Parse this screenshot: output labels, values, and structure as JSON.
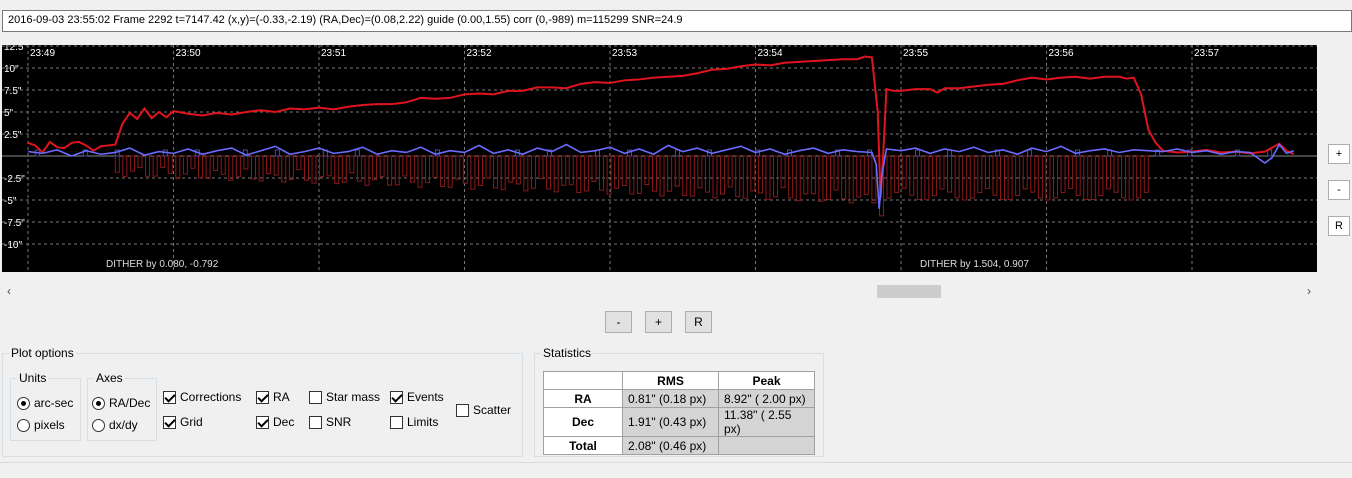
{
  "info_text": "2016-09-03 23:55:02 Frame 2292 t=7147.42 (x,y)=(-0.33,-2.19) (RA,Dec)=(0.08,2.22) guide (0.00,1.55) corr (0,-989) m=115299 SNR=24.9",
  "chart_data": {
    "type": "line",
    "x_ticks": [
      "23:49",
      "23:50",
      "23:51",
      "23:52",
      "23:53",
      "23:54",
      "23:55",
      "23:56",
      "23:57"
    ],
    "y_ticks": [
      "12.5\"",
      "10\"",
      "7.5\"",
      "5\"",
      "2.5\"",
      "-2.5\"",
      "-5\"",
      "-7.5\"",
      "-10\""
    ],
    "ylim": [
      -11,
      13.5
    ],
    "grid": true,
    "annotations": [
      {
        "label": "DITHER by 0.080, -0.792",
        "x": "23:49:35"
      },
      {
        "label": "DITHER by 1.504, 0.907",
        "x": "23:55:00"
      }
    ],
    "series": [
      {
        "name": "RA",
        "color": "#e0141e",
        "points": [
          [
            0,
            1.5
          ],
          [
            0.05,
            1.2
          ],
          [
            0.1,
            0.4
          ],
          [
            0.15,
            1.6
          ],
          [
            0.2,
            1.0
          ],
          [
            0.25,
            0.9
          ],
          [
            0.3,
            1.5
          ],
          [
            0.35,
            1.6
          ],
          [
            0.4,
            1.2
          ],
          [
            0.45,
            0.6
          ],
          [
            0.5,
            1.1
          ],
          [
            0.55,
            1.2
          ],
          [
            0.6,
            1.3
          ],
          [
            0.65,
            3.7
          ],
          [
            0.7,
            4.9
          ],
          [
            0.75,
            4.2
          ],
          [
            0.8,
            5.4
          ],
          [
            0.85,
            4.3
          ],
          [
            0.9,
            5.0
          ],
          [
            0.95,
            4.4
          ],
          [
            1.0,
            5.1
          ],
          [
            1.1,
            4.8
          ],
          [
            1.2,
            4.6
          ],
          [
            1.3,
            4.9
          ],
          [
            1.4,
            4.7
          ],
          [
            1.5,
            5.0
          ],
          [
            1.6,
            5.2
          ],
          [
            1.7,
            5.0
          ],
          [
            1.8,
            5.4
          ],
          [
            1.9,
            5.3
          ],
          [
            2.0,
            5.5
          ],
          [
            2.1,
            5.3
          ],
          [
            2.2,
            5.6
          ],
          [
            2.3,
            5.8
          ],
          [
            2.4,
            5.9
          ],
          [
            2.5,
            5.9
          ],
          [
            2.6,
            6.1
          ],
          [
            2.7,
            6.6
          ],
          [
            2.8,
            6.5
          ],
          [
            2.9,
            6.6
          ],
          [
            3.0,
            7.0
          ],
          [
            3.1,
            7.1
          ],
          [
            3.2,
            7.0
          ],
          [
            3.3,
            7.4
          ],
          [
            3.4,
            7.4
          ],
          [
            3.5,
            7.8
          ],
          [
            3.6,
            7.8
          ],
          [
            3.7,
            7.7
          ],
          [
            3.8,
            8.2
          ],
          [
            3.9,
            8.4
          ],
          [
            4.0,
            8.3
          ],
          [
            4.1,
            8.6
          ],
          [
            4.2,
            8.7
          ],
          [
            4.3,
            8.9
          ],
          [
            4.4,
            9.0
          ],
          [
            4.5,
            9.1
          ],
          [
            4.6,
            9.4
          ],
          [
            4.7,
            9.8
          ],
          [
            4.8,
            9.9
          ],
          [
            4.9,
            10.2
          ],
          [
            5.0,
            10.4
          ],
          [
            5.1,
            10.3
          ],
          [
            5.2,
            10.6
          ],
          [
            5.3,
            10.7
          ],
          [
            5.4,
            10.8
          ],
          [
            5.5,
            10.9
          ],
          [
            5.6,
            11.0
          ],
          [
            5.7,
            11.0
          ],
          [
            5.75,
            11.3
          ],
          [
            5.8,
            11.2
          ],
          [
            5.84,
            5.0
          ],
          [
            5.86,
            -4.8
          ],
          [
            5.88,
            1.0
          ],
          [
            5.9,
            7.6
          ],
          [
            5.95,
            7.4
          ],
          [
            6.0,
            7.4
          ],
          [
            6.1,
            7.6
          ],
          [
            6.2,
            7.6
          ],
          [
            6.25,
            7.2
          ],
          [
            6.3,
            7.7
          ],
          [
            6.4,
            7.7
          ],
          [
            6.5,
            7.9
          ],
          [
            6.6,
            8.1
          ],
          [
            6.7,
            8.2
          ],
          [
            6.8,
            8.6
          ],
          [
            6.9,
            8.9
          ],
          [
            7.0,
            8.7
          ],
          [
            7.1,
            8.9
          ],
          [
            7.2,
            9.0
          ],
          [
            7.3,
            8.8
          ],
          [
            7.4,
            9.0
          ],
          [
            7.5,
            9.0
          ],
          [
            7.55,
            8.8
          ],
          [
            7.6,
            8.9
          ],
          [
            7.65,
            7.0
          ],
          [
            7.7,
            3.0
          ],
          [
            7.75,
            1.5
          ],
          [
            7.8,
            0.6
          ],
          [
            7.9,
            0.4
          ],
          [
            8.0,
            0.5
          ],
          [
            8.1,
            0.7
          ],
          [
            8.2,
            0.4
          ],
          [
            8.3,
            0.5
          ],
          [
            8.4,
            0.3
          ],
          [
            8.5,
            0.5
          ],
          [
            8.6,
            1.4
          ],
          [
            8.65,
            0.6
          ],
          [
            8.7,
            0.2
          ]
        ]
      },
      {
        "name": "Dec",
        "color": "#6b6bff",
        "points": [
          [
            0,
            0.5
          ],
          [
            0.1,
            0.3
          ],
          [
            0.2,
            0.7
          ],
          [
            0.3,
            0.0
          ],
          [
            0.4,
            0.6
          ],
          [
            0.5,
            0.2
          ],
          [
            0.6,
            0.4
          ],
          [
            0.7,
            0.9
          ],
          [
            0.8,
            0.1
          ],
          [
            0.9,
            0.5
          ],
          [
            1.0,
            0.3
          ],
          [
            1.1,
            0.8
          ],
          [
            1.2,
            0.2
          ],
          [
            1.3,
            0.6
          ],
          [
            1.4,
            0.9
          ],
          [
            1.5,
            0.1
          ],
          [
            1.6,
            0.6
          ],
          [
            1.7,
            1.1
          ],
          [
            1.8,
            0.2
          ],
          [
            1.9,
            0.5
          ],
          [
            2.0,
            0.9
          ],
          [
            2.1,
            0.3
          ],
          [
            2.2,
            0.5
          ],
          [
            2.3,
            1.0
          ],
          [
            2.4,
            0.2
          ],
          [
            2.5,
            0.6
          ],
          [
            2.6,
            0.4
          ],
          [
            2.7,
            1.0
          ],
          [
            2.8,
            0.2
          ],
          [
            2.9,
            0.6
          ],
          [
            3.0,
            0.4
          ],
          [
            3.1,
            1.2
          ],
          [
            3.2,
            0.3
          ],
          [
            3.3,
            0.7
          ],
          [
            3.4,
            0.2
          ],
          [
            3.5,
            0.9
          ],
          [
            3.6,
            0.5
          ],
          [
            3.7,
            1.3
          ],
          [
            3.8,
            0.4
          ],
          [
            3.9,
            0.6
          ],
          [
            4.0,
            1.0
          ],
          [
            4.1,
            0.3
          ],
          [
            4.2,
            0.8
          ],
          [
            4.3,
            0.2
          ],
          [
            4.4,
            1.2
          ],
          [
            4.5,
            0.5
          ],
          [
            4.6,
            0.9
          ],
          [
            4.7,
            0.3
          ],
          [
            4.8,
            0.7
          ],
          [
            4.9,
            1.1
          ],
          [
            5.0,
            0.4
          ],
          [
            5.1,
            0.8
          ],
          [
            5.2,
            0.2
          ],
          [
            5.3,
            0.6
          ],
          [
            5.4,
            0.9
          ],
          [
            5.5,
            0.3
          ],
          [
            5.6,
            0.7
          ],
          [
            5.7,
            0.5
          ],
          [
            5.8,
            0.4
          ],
          [
            5.83,
            -1.0
          ],
          [
            5.85,
            -6.0
          ],
          [
            5.87,
            -2.0
          ],
          [
            5.9,
            0.8
          ],
          [
            6.0,
            0.6
          ],
          [
            6.1,
            0.9
          ],
          [
            6.2,
            0.3
          ],
          [
            6.3,
            0.8
          ],
          [
            6.4,
            0.5
          ],
          [
            6.5,
            1.0
          ],
          [
            6.6,
            0.4
          ],
          [
            6.7,
            0.7
          ],
          [
            6.8,
            0.2
          ],
          [
            6.9,
            0.9
          ],
          [
            7.0,
            0.5
          ],
          [
            7.1,
            1.1
          ],
          [
            7.2,
            0.3
          ],
          [
            7.3,
            0.6
          ],
          [
            7.4,
            0.8
          ],
          [
            7.5,
            0.4
          ],
          [
            7.6,
            0.7
          ],
          [
            7.7,
            0.6
          ],
          [
            7.8,
            0.5
          ],
          [
            7.9,
            0.8
          ],
          [
            8.0,
            0.4
          ],
          [
            8.1,
            0.6
          ],
          [
            8.2,
            0.2
          ],
          [
            8.3,
            0.5
          ],
          [
            8.4,
            0.4
          ],
          [
            8.5,
            -0.8
          ],
          [
            8.55,
            -0.2
          ],
          [
            8.6,
            1.3
          ],
          [
            8.65,
            0.3
          ],
          [
            8.7,
            0.6
          ]
        ]
      }
    ]
  },
  "zoom_buttons": [
    "+",
    "-",
    "R"
  ],
  "bottom_buttons": [
    "-",
    "+",
    "R"
  ],
  "plot_options": {
    "title": "Plot options",
    "units_title": "Units",
    "units": [
      "arc-sec",
      "pixels"
    ],
    "axes_title": "Axes",
    "axes": [
      "RA/Dec",
      "dx/dy"
    ],
    "checks": [
      {
        "label": "Corrections",
        "checked": true
      },
      {
        "label": "Grid",
        "checked": true
      },
      {
        "label": "RA",
        "checked": true
      },
      {
        "label": "Dec",
        "checked": true
      },
      {
        "label": "Star mass",
        "checked": false
      },
      {
        "label": "SNR",
        "checked": false
      },
      {
        "label": "Events",
        "checked": true
      },
      {
        "label": "Limits",
        "checked": false
      },
      {
        "label": "Scatter",
        "checked": false
      }
    ]
  },
  "statistics": {
    "title": "Statistics",
    "col_rms": "RMS",
    "col_peak": "Peak",
    "rows": [
      {
        "label": "RA",
        "rms": "0.81\" (0.18 px)",
        "peak": "8.92\" ( 2.00 px)"
      },
      {
        "label": "Dec",
        "rms": "1.91\" (0.43 px)",
        "peak": "11.38\" ( 2.55 px)"
      },
      {
        "label": "Total",
        "rms": "2.08\" (0.46 px)",
        "peak": ""
      }
    ]
  }
}
